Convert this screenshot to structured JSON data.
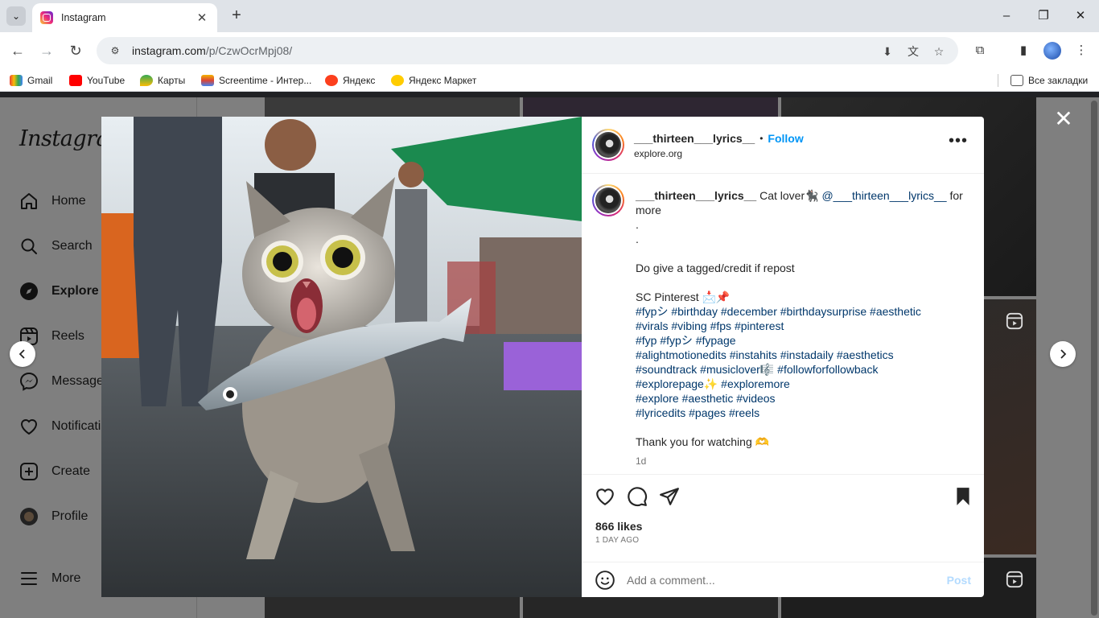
{
  "browser": {
    "tab_title": "Instagram",
    "url_host": "instagram.com",
    "url_path": "/p/CzwOcrMpj08/",
    "bookmarks": [
      "Gmail",
      "YouTube",
      "Карты",
      "Screentime - Интер...",
      "Яндекс",
      "Яндекс Маркет"
    ],
    "all_bookmarks": "Все закладки"
  },
  "sidebar": {
    "logo": "Instagram",
    "items": [
      "Home",
      "Search",
      "Explore",
      "Reels",
      "Messages",
      "Notifications",
      "Create",
      "Profile"
    ],
    "more": "More"
  },
  "post": {
    "username": "___thirteen___lyrics__",
    "separator": "•",
    "follow_label": "Follow",
    "location": "explore.org",
    "caption_intro": "Cat lover🐈‍⬛",
    "caption_mention": "@___thirteen___lyrics__",
    "caption_after_mention": "for",
    "caption_more": "more",
    "dot1": ".",
    "dot2": ".",
    "credit_line": "Do give a tagged/credit if repost",
    "sc_line": "SC Pinterest 📩📌",
    "hashtag_lines": [
      "#fypシ #birthday #december #birthdaysurprise #aesthetic",
      "#virals #vibing #fps #pinterest",
      "#fyp #fypシ #fypage",
      "#alightmotionedits #instahits #instadaily #aesthetics",
      "#soundtrack #musiclover🎼 #followforfollowback",
      "#explorepage✨ #exploremore",
      "#explore #aesthetic #videos",
      "#lyricedits #pages #reels"
    ],
    "thanks": "Thank you for watching 🫶",
    "caption_age": "1d",
    "likes": "866 likes",
    "date": "1 DAY AGO",
    "comment_placeholder": "Add a comment...",
    "post_label": "Post"
  }
}
